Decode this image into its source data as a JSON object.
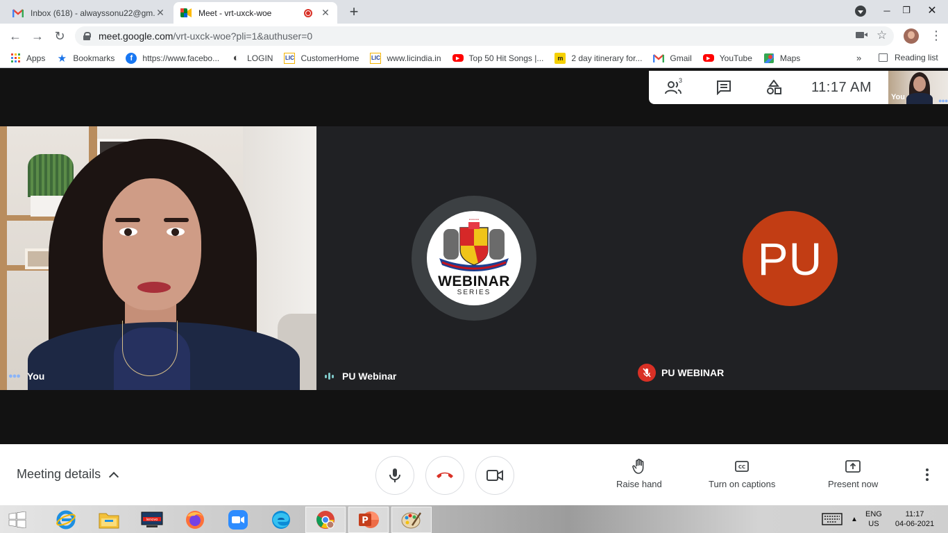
{
  "browser": {
    "tabs": [
      {
        "title": "Inbox (618) - alwayssonu22@gm...",
        "favicon": "gmail-icon",
        "active": false
      },
      {
        "title": "Meet - vrt-uxck-woe",
        "favicon": "meet-icon",
        "active": true,
        "recording": true
      }
    ],
    "url": {
      "host": "meet.google.com",
      "path": "/vrt-uxck-woe?pli=1&authuser=0"
    },
    "bookmarks": [
      {
        "label": "Apps",
        "icon": "apps-grid-icon"
      },
      {
        "label": "Bookmarks",
        "icon": "star-icon"
      },
      {
        "label": "https://www.facebo...",
        "icon": "facebook-icon"
      },
      {
        "label": "LOGIN",
        "icon": "login-icon"
      },
      {
        "label": "CustomerHome",
        "icon": "lic-icon"
      },
      {
        "label": "www.licindia.in",
        "icon": "lic-icon"
      },
      {
        "label": "Top 50 Hit Songs |...",
        "icon": "youtube-icon"
      },
      {
        "label": "2 day itinerary for...",
        "icon": "makemytrip-icon"
      },
      {
        "label": "Gmail",
        "icon": "gmail-icon"
      },
      {
        "label": "YouTube",
        "icon": "youtube-icon"
      },
      {
        "label": "Maps",
        "icon": "maps-icon"
      }
    ],
    "more_chevron": "»",
    "reading_list": "Reading list"
  },
  "meet": {
    "participant_count": "3",
    "clock": "11:17  AM",
    "self_preview_label": "You",
    "tiles": [
      {
        "name": "You"
      },
      {
        "name": "PU Webinar",
        "logo_title": "WEBINAR",
        "logo_subtitle": "SERIES"
      },
      {
        "name": "PU WEBINAR",
        "initials": "PU",
        "muted": true
      }
    ],
    "controls": {
      "meeting_details": "Meeting details",
      "raise_hand": "Raise hand",
      "captions": "Turn on captions",
      "present": "Present now"
    }
  },
  "taskbar": {
    "lang_top": "ENG",
    "lang_bottom": "US",
    "time": "11:17",
    "date": "04-06-2021"
  },
  "colors": {
    "meet_bg": "#202124",
    "accent_blue": "#8ab4f8",
    "end_call_red": "#d93025",
    "avatar_orange": "#c23d14"
  }
}
